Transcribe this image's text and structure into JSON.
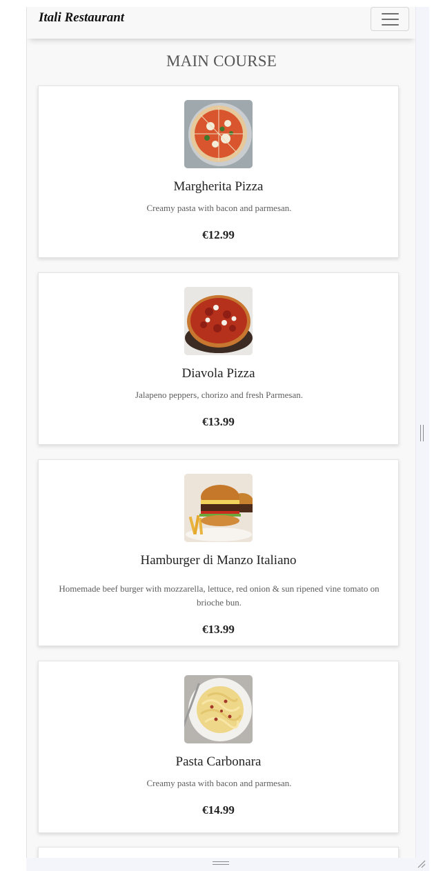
{
  "navbar": {
    "brand": "Itali Restaurant",
    "menu_icon": "hamburger-menu-icon"
  },
  "section": {
    "title": "MAIN COURSE"
  },
  "menu_items": [
    {
      "name": "Margherita Pizza",
      "description": "Creamy pasta with bacon and parmesan.",
      "price": "€12.99",
      "image": "margherita-pizza-photo"
    },
    {
      "name": "Diavola Pizza",
      "description": "Jalapeno peppers, chorizo and fresh Parmesan.",
      "price": "€13.99",
      "image": "diavola-pizza-photo"
    },
    {
      "name": "Hamburger di Manzo Italiano",
      "description": "Homemade beef burger with mozzarella, lettuce, red onion & sun ripened vine tomato on brioche bun.",
      "price": "€13.99",
      "image": "hamburger-photo"
    },
    {
      "name": "Pasta Carbonara",
      "description": "Creamy pasta with bacon and parmesan.",
      "price": "€14.99",
      "image": "pasta-carbonara-photo"
    }
  ],
  "colors": {
    "navbar_bg": "#f8f8f8",
    "page_bg": "#f8f8f8",
    "card_bg": "#ffffff",
    "title_text": "#555555",
    "price_text": "#222222"
  }
}
